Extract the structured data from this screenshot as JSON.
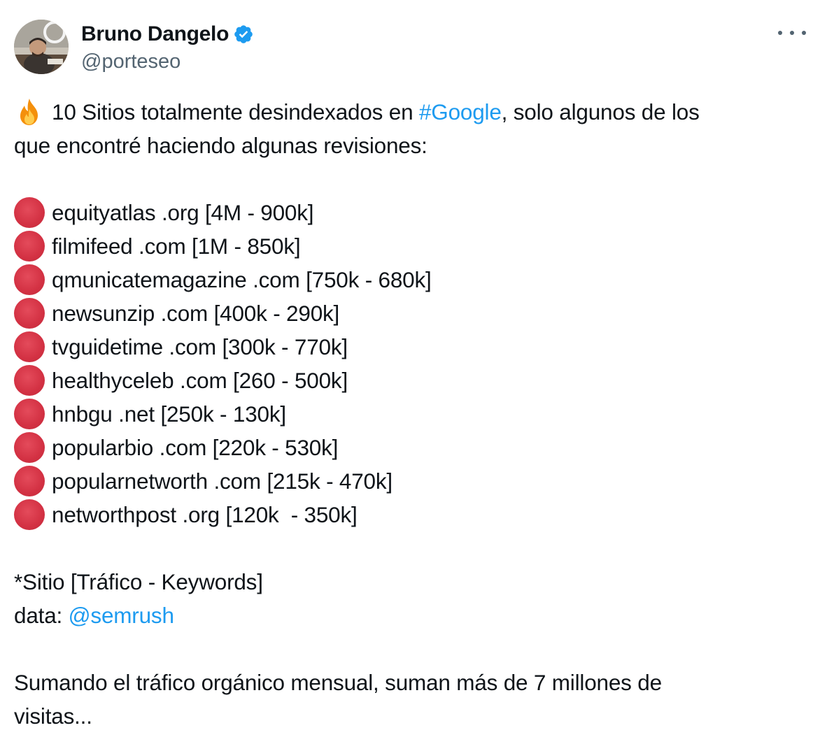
{
  "author": {
    "display_name": "Bruno Dangelo",
    "handle": "@porteseo",
    "verified": true
  },
  "colors": {
    "link": "#1d9bf0",
    "dot": "#dd2e44",
    "verified_badge": "#1d9bf0",
    "secondary_text": "#536471"
  },
  "icons": {
    "intro": "fire-icon",
    "list_bullet": "red-circle-icon",
    "menu": "more-icon",
    "badge": "verified-badge-icon"
  },
  "tweet": {
    "intro_part1": "10 Sitios totalmente desindexados en ",
    "hashtag": "#Google",
    "intro_part2": ", solo algunos de los",
    "intro_line2": "que encontré haciendo algunas revisiones:",
    "sites": [
      "equityatlas .org [4M - 900k]",
      "filmifeed .com [1M - 850k]",
      "qmunicatemagazine .com [750k - 680k]",
      "newsunzip .com [400k - 290k]",
      "tvguidetime .com [300k - 770k]",
      "healthyceleb .com [260 - 500k]",
      "hnbgu .net [250k - 130k]",
      "popularbio .com [220k - 530k]",
      "popularnetworth .com [215k - 470k]",
      "networthpost .org [120k  - 350k]"
    ],
    "legend": "*Sitio [Tráfico - Keywords]",
    "data_label": "data: ",
    "data_mention": "@semrush",
    "summary_line1": "Sumando el tráfico orgánico mensual, suman más de 7 millones de",
    "summary_line2": "visitas..."
  }
}
